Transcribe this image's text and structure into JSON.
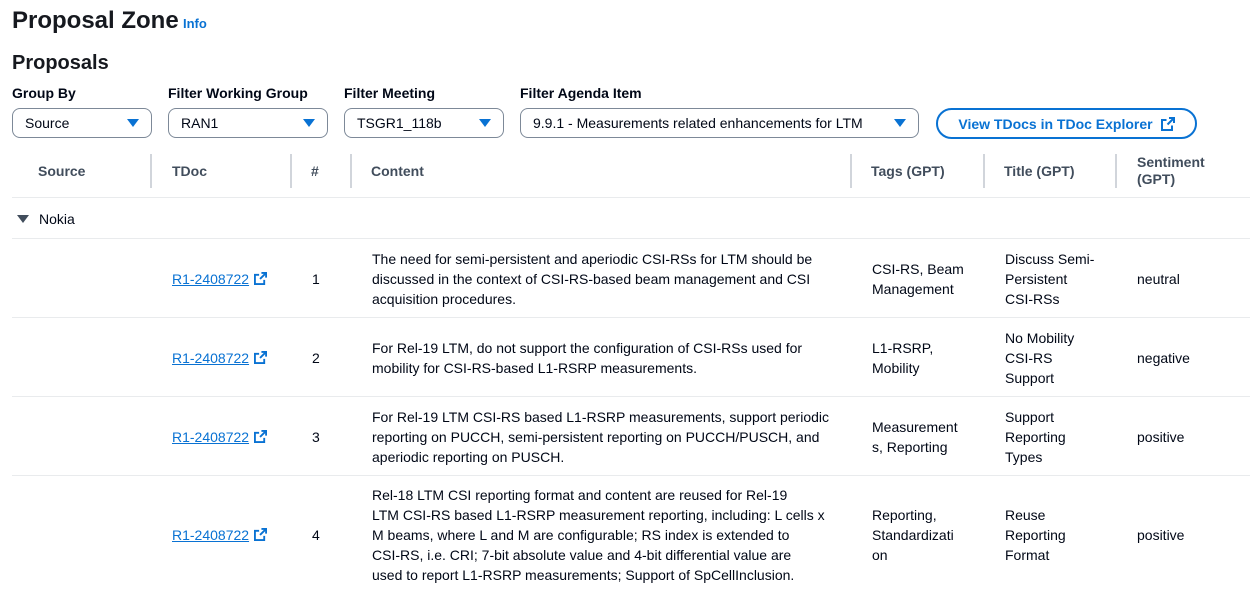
{
  "page": {
    "title": "Proposal Zone",
    "info_label": "Info",
    "section_title": "Proposals"
  },
  "filters": {
    "group_by": {
      "label": "Group By",
      "value": "Source"
    },
    "working_group": {
      "label": "Filter Working Group",
      "value": "RAN1"
    },
    "meeting": {
      "label": "Filter Meeting",
      "value": "TSGR1_118b"
    },
    "agenda_item": {
      "label": "Filter Agenda Item",
      "value": "9.9.1 - Measurements related enhancements for LTM"
    }
  },
  "view_button": {
    "label": "View TDocs in TDoc Explorer"
  },
  "columns": {
    "source": "Source",
    "tdoc": "TDoc",
    "num": "#",
    "content": "Content",
    "tags": "Tags (GPT)",
    "title": "Title (GPT)",
    "sentiment_line1": "Sentiment",
    "sentiment_line2": "(GPT)"
  },
  "group": {
    "name": "Nokia"
  },
  "rows": [
    {
      "tdoc": "R1-2408722",
      "num": "1",
      "content": [
        "The need for semi-persistent and aperiodic CSI-RSs for LTM should be",
        "discussed in the context of CSI-RS-based beam management and CSI",
        "acquisition procedures."
      ],
      "tags": [
        "CSI-RS, Beam",
        "Management"
      ],
      "title": [
        "Discuss Semi-",
        "Persistent",
        "CSI-RSs"
      ],
      "sentiment": "neutral"
    },
    {
      "tdoc": "R1-2408722",
      "num": "2",
      "content": [
        "For Rel-19 LTM, do not support the configuration of CSI-RSs used for",
        "mobility for CSI-RS-based L1-RSRP measurements."
      ],
      "tags": [
        "L1-RSRP,",
        "Mobility"
      ],
      "title": [
        "No Mobility",
        "CSI-RS",
        "Support"
      ],
      "sentiment": "negative"
    },
    {
      "tdoc": "R1-2408722",
      "num": "3",
      "content": [
        "For Rel-19 LTM CSI-RS based L1-RSRP measurements, support periodic",
        "reporting on PUCCH, semi-persistent reporting on PUCCH/PUSCH, and",
        "aperiodic reporting on PUSCH."
      ],
      "tags": [
        "Measurement",
        "s, Reporting"
      ],
      "title": [
        "Support",
        "Reporting",
        "Types"
      ],
      "sentiment": "positive"
    },
    {
      "tdoc": "R1-2408722",
      "num": "4",
      "content": [
        "Rel-18 LTM CSI reporting format and content are reused for Rel-19",
        "LTM CSI-RS based L1-RSRP measurement reporting, including: L cells x",
        "M beams, where L and M are configurable; RS index is extended to",
        "CSI-RS, i.e. CRI; 7-bit absolute value and 4-bit differential value are",
        "used to report L1-RSRP measurements; Support of SpCellInclusion."
      ],
      "tags": [
        "Reporting,",
        "Standardizati",
        "on"
      ],
      "title": [
        "Reuse",
        "Reporting",
        "Format"
      ],
      "sentiment": "positive"
    }
  ]
}
